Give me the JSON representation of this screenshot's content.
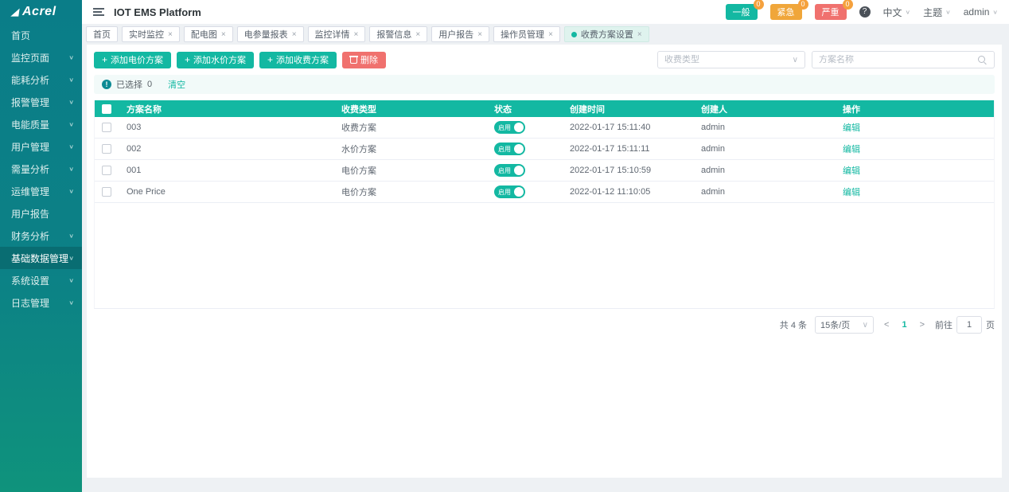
{
  "logo": {
    "text": "Acrel"
  },
  "sidebar": {
    "items": [
      {
        "label": "首页",
        "expandable": false
      },
      {
        "label": "监控页面",
        "expandable": true
      },
      {
        "label": "能耗分析",
        "expandable": true
      },
      {
        "label": "报警管理",
        "expandable": true
      },
      {
        "label": "电能质量",
        "expandable": true
      },
      {
        "label": "用户管理",
        "expandable": true
      },
      {
        "label": "需量分析",
        "expandable": true
      },
      {
        "label": "运维管理",
        "expandable": true
      },
      {
        "label": "用户报告",
        "expandable": false
      },
      {
        "label": "财务分析",
        "expandable": true
      },
      {
        "label": "基础数据管理",
        "expandable": true
      },
      {
        "label": "系统设置",
        "expandable": true
      },
      {
        "label": "日志管理",
        "expandable": true
      }
    ]
  },
  "header": {
    "title": "IOT EMS Platform",
    "alarms": [
      {
        "label": "一般",
        "count": "0",
        "color": "#13b8a2"
      },
      {
        "label": "紧急",
        "count": "0",
        "color": "#f0a63a"
      },
      {
        "label": "严重",
        "count": "0",
        "color": "#f0716e"
      }
    ],
    "help": "?",
    "language": "中文",
    "theme": "主题",
    "user": "admin"
  },
  "tabs": [
    {
      "label": "首页"
    },
    {
      "label": "实时监控"
    },
    {
      "label": "配电图"
    },
    {
      "label": "电参量报表"
    },
    {
      "label": "监控详情"
    },
    {
      "label": "报警信息"
    },
    {
      "label": "用户报告"
    },
    {
      "label": "操作员管理"
    },
    {
      "label": "收费方案设置"
    }
  ],
  "toolbar": {
    "add_buttons": [
      {
        "label": "添加电价方案"
      },
      {
        "label": "添加水价方案"
      },
      {
        "label": "添加收费方案"
      }
    ],
    "delete_label": "删除"
  },
  "filters": {
    "type_placeholder": "收费类型",
    "name_placeholder": "方案名称"
  },
  "selection_bar": {
    "selected_label": "已选择",
    "selected_count": "0",
    "clear_label": "清空"
  },
  "table": {
    "columns": [
      "方案名称",
      "收费类型",
      "状态",
      "创建时间",
      "创建人",
      "操作"
    ],
    "status_on_label": "启用",
    "action_label": "编辑",
    "rows": [
      {
        "name": "003",
        "type": "收费方案",
        "status": "启用",
        "created": "2022-01-17 15:11:40",
        "creator": "admin",
        "action": "编辑"
      },
      {
        "name": "002",
        "type": "水价方案",
        "status": "启用",
        "created": "2022-01-17 15:11:11",
        "creator": "admin",
        "action": "编辑"
      },
      {
        "name": "001",
        "type": "电价方案",
        "status": "启用",
        "created": "2022-01-17 15:10:59",
        "creator": "admin",
        "action": "编辑"
      },
      {
        "name": "One Price",
        "type": "电价方案",
        "status": "启用",
        "created": "2022-01-12 11:10:05",
        "creator": "admin",
        "action": "编辑"
      }
    ]
  },
  "pagination": {
    "total_label": "共 4 条",
    "page_size": "15条/页",
    "prev": "<",
    "current_page": "1",
    "next": ">",
    "goto_label": "前往",
    "goto_value": "1",
    "page_suffix": "页"
  }
}
